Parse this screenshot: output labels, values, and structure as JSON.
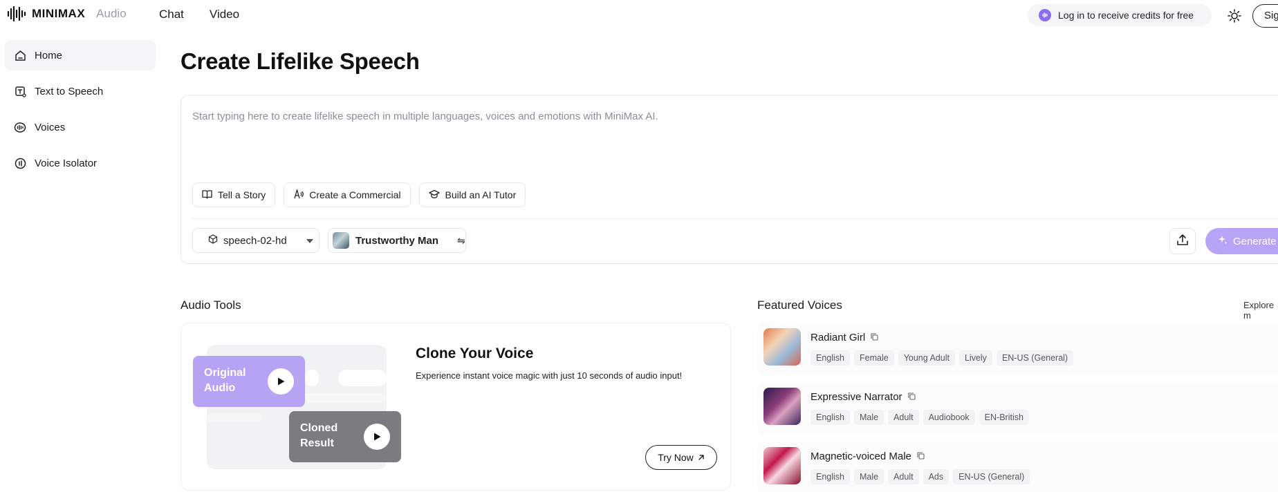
{
  "header": {
    "brand": "MINIMAX",
    "product": "Audio",
    "nav": [
      {
        "label": "Chat"
      },
      {
        "label": "Video"
      }
    ],
    "credits_text": "Log in to receive credits for free",
    "signin_label": "Sig"
  },
  "sidebar": {
    "items": [
      {
        "label": "Home",
        "icon": "home-icon"
      },
      {
        "label": "Text to Speech",
        "icon": "text-to-speech-icon"
      },
      {
        "label": "Voices",
        "icon": "voices-icon"
      },
      {
        "label": "Voice Isolator",
        "icon": "voice-isolator-icon"
      }
    ]
  },
  "main": {
    "title": "Create Lifelike Speech",
    "editor": {
      "placeholder": "Start typing here to create lifelike speech in multiple languages, voices and emotions with MiniMax AI."
    },
    "prompts": [
      {
        "label": "Tell a Story",
        "icon": "book-icon"
      },
      {
        "label": "Create a Commercial",
        "icon": "commercial-icon"
      },
      {
        "label": "Build an AI Tutor",
        "icon": "graduation-cap-icon"
      }
    ],
    "model": "speech-02-hd",
    "voice": "Trustworthy Man",
    "generate_label": "Generate"
  },
  "audio_tools": {
    "heading": "Audio Tools",
    "card": {
      "original_label_1": "Original",
      "original_label_2": "Audio",
      "cloned_label_1": "Cloned",
      "cloned_label_2": "Result",
      "title": "Clone Your Voice",
      "description": "Experience instant voice magic with just 10 seconds of audio input!",
      "cta": "Try Now"
    }
  },
  "featured_voices": {
    "heading": "Featured Voices",
    "explore_label": "Explore m",
    "voices": [
      {
        "name": "Radiant Girl",
        "tags": [
          "English",
          "Female",
          "Young Adult",
          "Lively",
          "EN-US (General)"
        ]
      },
      {
        "name": "Expressive Narrator",
        "tags": [
          "English",
          "Male",
          "Adult",
          "Audiobook",
          "EN-British"
        ]
      },
      {
        "name": "Magnetic-voiced Male",
        "tags": [
          "English",
          "Male",
          "Adult",
          "Ads",
          "EN-US (General)"
        ]
      }
    ]
  },
  "colors": {
    "accent": "#8b6cf3",
    "accent_light": "#b7a3f4",
    "cloned_gray": "#7a7c80"
  }
}
